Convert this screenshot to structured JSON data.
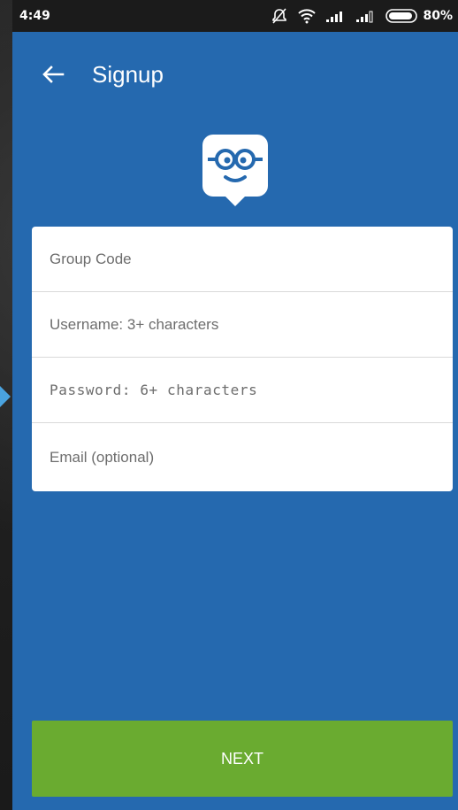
{
  "status_bar": {
    "time": "4:49",
    "battery": "80%"
  },
  "toolbar": {
    "title": "Signup"
  },
  "form": {
    "group_code_placeholder": "Group Code",
    "username_placeholder": "Username: 3+ characters",
    "password_placeholder": "Password: 6+ characters",
    "email_placeholder": "Email (optional)"
  },
  "actions": {
    "next_label": "NEXT"
  },
  "colors": {
    "primary": "#2569af",
    "status_bar": "#1b1b1b",
    "next_button": "#6aab30",
    "card": "#ffffff"
  },
  "icons": [
    "back-arrow-icon",
    "mute-icon",
    "wifi-icon",
    "signal-icon",
    "battery-icon",
    "edmodo-logo-icon"
  ]
}
